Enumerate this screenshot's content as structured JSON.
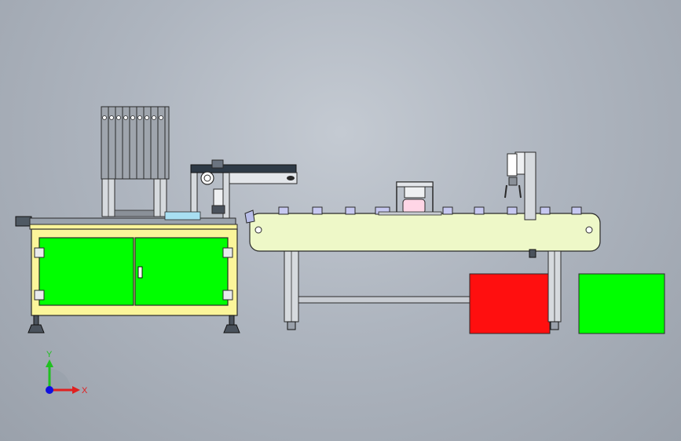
{
  "viewport": {
    "background_top": "#c4cad2",
    "background_bottom": "#9aa1ab"
  },
  "colors": {
    "cabinet_frame": "#fbf59a",
    "cabinet_panel": "#00ff00",
    "conveyor_belt": "#eef8c8",
    "red_bin": "#ff0f0f",
    "green_bin": "#00ff00",
    "profile_gray": "#c8ccd2",
    "outline": "#2a2a2a"
  },
  "triad": {
    "x_label": "X",
    "y_label": "Y",
    "x_color": "#e02020",
    "y_color": "#20c020",
    "z_color": "#1010e0"
  },
  "components": [
    "tube-magazine-rack",
    "feeder-cabinet",
    "transfer-gantry",
    "belt-conveyor",
    "press-station",
    "pick-and-place-gripper",
    "reject-bin-red",
    "accept-bin-green",
    "coordinate-triad"
  ]
}
